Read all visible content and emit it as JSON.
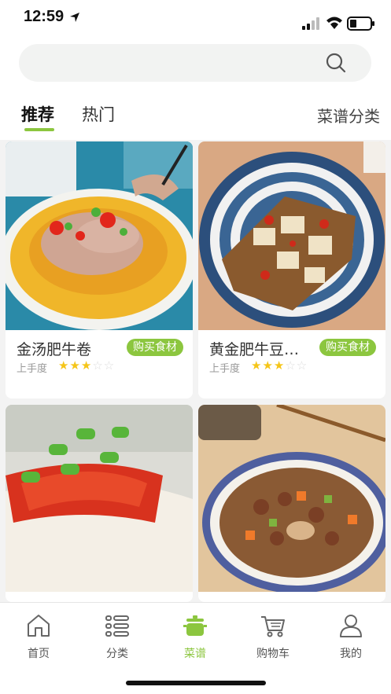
{
  "status_bar": {
    "time": "12:59"
  },
  "search": {
    "placeholder": ""
  },
  "tabs": [
    {
      "label": "推荐",
      "active": true
    },
    {
      "label": "热门",
      "active": false
    }
  ],
  "category_link": "菜谱分类",
  "recipes": [
    {
      "title": "金汤肥牛卷",
      "buy_label": "购买食材",
      "difficulty_label": "上手度",
      "rating": 3,
      "max_rating": 5,
      "image": "golden-soup-beef-rolls"
    },
    {
      "title": "黄金肥牛豆…",
      "buy_label": "购买食材",
      "difficulty_label": "上手度",
      "rating": 3,
      "max_rating": 5,
      "image": "golden-beef-tofu"
    },
    {
      "title": "",
      "image": "steamed-fish-with-chili"
    },
    {
      "title": "",
      "image": "braised-peanuts-chicken"
    }
  ],
  "nav": [
    {
      "label": "首页",
      "icon": "home-icon",
      "active": false
    },
    {
      "label": "分类",
      "icon": "list-icon",
      "active": false
    },
    {
      "label": "菜谱",
      "icon": "pot-icon",
      "active": true
    },
    {
      "label": "购物车",
      "icon": "cart-icon",
      "active": false
    },
    {
      "label": "我的",
      "icon": "user-icon",
      "active": false
    }
  ],
  "colors": {
    "accent": "#8cc63f",
    "star": "#f5c518"
  }
}
